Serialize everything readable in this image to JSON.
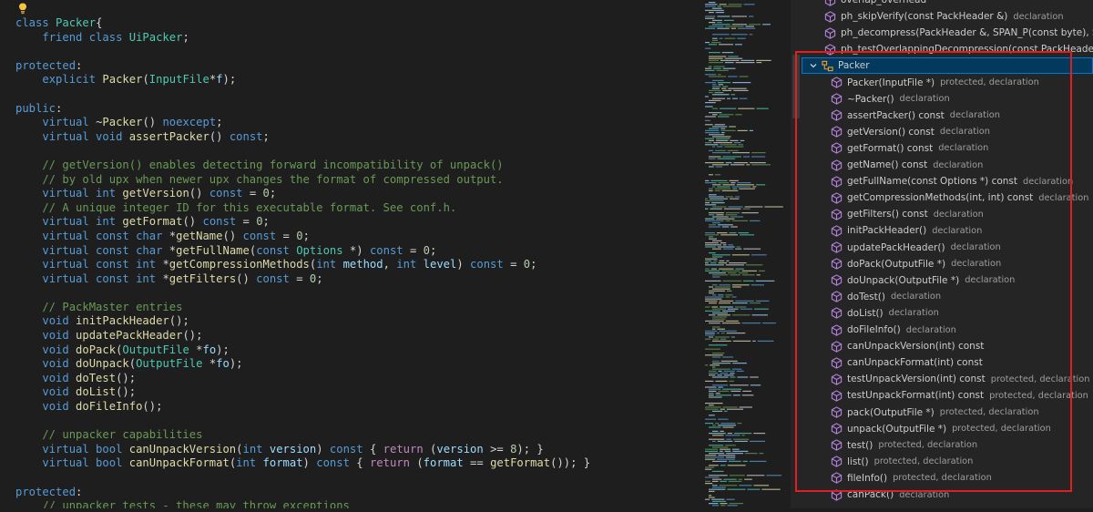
{
  "editor": {
    "lines": [
      [
        [
          "kw",
          "class "
        ],
        [
          "ty",
          "Packer"
        ],
        [
          "",
          "{"
        ]
      ],
      [
        [
          "",
          "    "
        ],
        [
          "kw",
          "friend class "
        ],
        [
          "ty",
          "UiPacker"
        ],
        [
          "",
          ";"
        ]
      ],
      [
        [
          "",
          ""
        ]
      ],
      [
        [
          "kw",
          "protected"
        ],
        [
          "",
          ":"
        ]
      ],
      [
        [
          "",
          "    "
        ],
        [
          "kw",
          "explicit "
        ],
        [
          "fn",
          "Packer"
        ],
        [
          "",
          "("
        ],
        [
          "ty",
          "InputFile"
        ],
        [
          "",
          "*"
        ],
        [
          "pm",
          "f"
        ],
        [
          "",
          ");"
        ]
      ],
      [
        [
          "",
          ""
        ]
      ],
      [
        [
          "kw",
          "public"
        ],
        [
          "",
          ":"
        ]
      ],
      [
        [
          "",
          "    "
        ],
        [
          "kw",
          "virtual "
        ],
        [
          "",
          "~"
        ],
        [
          "fn",
          "Packer"
        ],
        [
          "",
          "() "
        ],
        [
          "kw",
          "noexcept"
        ],
        [
          "",
          ";"
        ]
      ],
      [
        [
          "",
          "    "
        ],
        [
          "kw",
          "virtual void "
        ],
        [
          "fn",
          "assertPacker"
        ],
        [
          "",
          "() "
        ],
        [
          "kw",
          "const"
        ],
        [
          "",
          ";"
        ]
      ],
      [
        [
          "",
          ""
        ]
      ],
      [
        [
          "cm",
          "    // getVersion() enables detecting forward incompatibility of unpack()"
        ]
      ],
      [
        [
          "cm",
          "    // by old upx when newer upx changes the format of compressed output."
        ]
      ],
      [
        [
          "",
          "    "
        ],
        [
          "kw",
          "virtual int "
        ],
        [
          "fn",
          "getVersion"
        ],
        [
          "",
          "() "
        ],
        [
          "kw",
          "const "
        ],
        [
          "",
          "= "
        ],
        [
          "nu",
          "0"
        ],
        [
          "",
          ";"
        ]
      ],
      [
        [
          "cm",
          "    // A unique integer ID for this executable format. See conf.h."
        ]
      ],
      [
        [
          "",
          "    "
        ],
        [
          "kw",
          "virtual int "
        ],
        [
          "fn",
          "getFormat"
        ],
        [
          "",
          "() "
        ],
        [
          "kw",
          "const "
        ],
        [
          "",
          "= "
        ],
        [
          "nu",
          "0"
        ],
        [
          "",
          ";"
        ]
      ],
      [
        [
          "",
          "    "
        ],
        [
          "kw",
          "virtual const char "
        ],
        [
          "",
          "*"
        ],
        [
          "fn",
          "getName"
        ],
        [
          "",
          "() "
        ],
        [
          "kw",
          "const "
        ],
        [
          "",
          "= "
        ],
        [
          "nu",
          "0"
        ],
        [
          "",
          ";"
        ]
      ],
      [
        [
          "",
          "    "
        ],
        [
          "kw",
          "virtual const char "
        ],
        [
          "",
          "*"
        ],
        [
          "fn",
          "getFullName"
        ],
        [
          "",
          "("
        ],
        [
          "kw",
          "const "
        ],
        [
          "ty",
          "Options "
        ],
        [
          "",
          "*) "
        ],
        [
          "kw",
          "const "
        ],
        [
          "",
          "= "
        ],
        [
          "nu",
          "0"
        ],
        [
          "",
          ";"
        ]
      ],
      [
        [
          "",
          "    "
        ],
        [
          "kw",
          "virtual const int "
        ],
        [
          "",
          "*"
        ],
        [
          "fn",
          "getCompressionMethods"
        ],
        [
          "",
          "("
        ],
        [
          "kw",
          "int "
        ],
        [
          "pm",
          "method"
        ],
        [
          "",
          ", "
        ],
        [
          "kw",
          "int "
        ],
        [
          "pm",
          "level"
        ],
        [
          "",
          ") "
        ],
        [
          "kw",
          "const "
        ],
        [
          "",
          "= "
        ],
        [
          "nu",
          "0"
        ],
        [
          "",
          ";"
        ]
      ],
      [
        [
          "",
          "    "
        ],
        [
          "kw",
          "virtual const int "
        ],
        [
          "",
          "*"
        ],
        [
          "fn",
          "getFilters"
        ],
        [
          "",
          "() "
        ],
        [
          "kw",
          "const "
        ],
        [
          "",
          "= "
        ],
        [
          "nu",
          "0"
        ],
        [
          "",
          ";"
        ]
      ],
      [
        [
          "",
          ""
        ]
      ],
      [
        [
          "cm",
          "    // PackMaster entries"
        ]
      ],
      [
        [
          "",
          "    "
        ],
        [
          "kw",
          "void "
        ],
        [
          "fn",
          "initPackHeader"
        ],
        [
          "",
          "();"
        ]
      ],
      [
        [
          "",
          "    "
        ],
        [
          "kw",
          "void "
        ],
        [
          "fn",
          "updatePackHeader"
        ],
        [
          "",
          "();"
        ]
      ],
      [
        [
          "",
          "    "
        ],
        [
          "kw",
          "void "
        ],
        [
          "fn",
          "doPack"
        ],
        [
          "",
          "("
        ],
        [
          "ty",
          "OutputFile "
        ],
        [
          "",
          "*"
        ],
        [
          "pm",
          "fo"
        ],
        [
          "",
          ");"
        ]
      ],
      [
        [
          "",
          "    "
        ],
        [
          "kw",
          "void "
        ],
        [
          "fn",
          "doUnpack"
        ],
        [
          "",
          "("
        ],
        [
          "ty",
          "OutputFile "
        ],
        [
          "",
          "*"
        ],
        [
          "pm",
          "fo"
        ],
        [
          "",
          ");"
        ]
      ],
      [
        [
          "",
          "    "
        ],
        [
          "kw",
          "void "
        ],
        [
          "fn",
          "doTest"
        ],
        [
          "",
          "();"
        ]
      ],
      [
        [
          "",
          "    "
        ],
        [
          "kw",
          "void "
        ],
        [
          "fn",
          "doList"
        ],
        [
          "",
          "();"
        ]
      ],
      [
        [
          "",
          "    "
        ],
        [
          "kw",
          "void "
        ],
        [
          "fn",
          "doFileInfo"
        ],
        [
          "",
          "();"
        ]
      ],
      [
        [
          "",
          ""
        ]
      ],
      [
        [
          "cm",
          "    // unpacker capabilities"
        ]
      ],
      [
        [
          "",
          "    "
        ],
        [
          "kw",
          "virtual bool "
        ],
        [
          "fn",
          "canUnpackVersion"
        ],
        [
          "",
          "("
        ],
        [
          "kw",
          "int "
        ],
        [
          "pm",
          "version"
        ],
        [
          "",
          ") "
        ],
        [
          "kw",
          "const "
        ],
        [
          "",
          "{ "
        ],
        [
          "ct",
          "return "
        ],
        [
          "",
          "("
        ],
        [
          "pm",
          "version "
        ],
        [
          "",
          ">= "
        ],
        [
          "nu",
          "8"
        ],
        [
          "",
          "); }"
        ]
      ],
      [
        [
          "",
          "    "
        ],
        [
          "kw",
          "virtual bool "
        ],
        [
          "fn",
          "canUnpackFormat"
        ],
        [
          "",
          "("
        ],
        [
          "kw",
          "int "
        ],
        [
          "pm",
          "format"
        ],
        [
          "",
          ") "
        ],
        [
          "kw",
          "const "
        ],
        [
          "",
          "{ "
        ],
        [
          "ct",
          "return "
        ],
        [
          "",
          "("
        ],
        [
          "pm",
          "format "
        ],
        [
          "",
          "== "
        ],
        [
          "fn",
          "getFormat"
        ],
        [
          "",
          "()); }"
        ]
      ],
      [
        [
          "",
          ""
        ]
      ],
      [
        [
          "kw",
          "protected"
        ],
        [
          "",
          ":"
        ]
      ],
      [
        [
          "cm",
          "    // unpacker tests - these may throw exceptions"
        ]
      ]
    ]
  },
  "outline": {
    "items": [
      {
        "label": "overlap_overhead",
        "desc": "",
        "sel": false,
        "parent": false
      },
      {
        "label": "ph_skipVerify(const PackHeader &)",
        "desc": "declaration",
        "sel": false,
        "parent": false
      },
      {
        "label": "ph_decompress(PackHeader &, SPAN_P(const byte), SPAN_P(byte), bool, Filter *)",
        "desc": "",
        "sel": false,
        "parent": false
      },
      {
        "label": "ph_testOverlappingDecompression(const PackHeader &, SPAN_P(const byte), unsigned)",
        "desc": "",
        "sel": false,
        "parent": false
      },
      {
        "label": "Packer",
        "desc": "",
        "sel": true,
        "parent": true
      },
      {
        "label": "Packer(InputFile *)",
        "desc": "protected, declaration",
        "sel": false,
        "parent": false
      },
      {
        "label": "~Packer()",
        "desc": "declaration",
        "sel": false,
        "parent": false
      },
      {
        "label": "assertPacker() const",
        "desc": "declaration",
        "sel": false,
        "parent": false
      },
      {
        "label": "getVersion() const",
        "desc": "declaration",
        "sel": false,
        "parent": false
      },
      {
        "label": "getFormat() const",
        "desc": "declaration",
        "sel": false,
        "parent": false
      },
      {
        "label": "getName() const",
        "desc": "declaration",
        "sel": false,
        "parent": false
      },
      {
        "label": "getFullName(const Options *) const",
        "desc": "declaration",
        "sel": false,
        "parent": false
      },
      {
        "label": "getCompressionMethods(int, int) const",
        "desc": "declaration",
        "sel": false,
        "parent": false
      },
      {
        "label": "getFilters() const",
        "desc": "declaration",
        "sel": false,
        "parent": false
      },
      {
        "label": "initPackHeader()",
        "desc": "declaration",
        "sel": false,
        "parent": false
      },
      {
        "label": "updatePackHeader()",
        "desc": "declaration",
        "sel": false,
        "parent": false
      },
      {
        "label": "doPack(OutputFile *)",
        "desc": "declaration",
        "sel": false,
        "parent": false
      },
      {
        "label": "doUnpack(OutputFile *)",
        "desc": "declaration",
        "sel": false,
        "parent": false
      },
      {
        "label": "doTest()",
        "desc": "declaration",
        "sel": false,
        "parent": false
      },
      {
        "label": "doList()",
        "desc": "declaration",
        "sel": false,
        "parent": false
      },
      {
        "label": "doFileInfo()",
        "desc": "declaration",
        "sel": false,
        "parent": false
      },
      {
        "label": "canUnpackVersion(int) const",
        "desc": "",
        "sel": false,
        "parent": false
      },
      {
        "label": "canUnpackFormat(int) const",
        "desc": "",
        "sel": false,
        "parent": false
      },
      {
        "label": "testUnpackVersion(int) const",
        "desc": "protected, declaration",
        "sel": false,
        "parent": false
      },
      {
        "label": "testUnpackFormat(int) const",
        "desc": "protected, declaration",
        "sel": false,
        "parent": false
      },
      {
        "label": "pack(OutputFile *)",
        "desc": "protected, declaration",
        "sel": false,
        "parent": false
      },
      {
        "label": "unpack(OutputFile *)",
        "desc": "protected, declaration",
        "sel": false,
        "parent": false
      },
      {
        "label": "test()",
        "desc": "protected, declaration",
        "sel": false,
        "parent": false
      },
      {
        "label": "list()",
        "desc": "protected, declaration",
        "sel": false,
        "parent": false
      },
      {
        "label": "fileInfo()",
        "desc": "protected, declaration",
        "sel": false,
        "parent": false
      },
      {
        "label": "canPack()",
        "desc": "declaration",
        "sel": false,
        "parent": false
      }
    ]
  },
  "colors": {
    "editor_bg": "#1e1e1e",
    "panel_bg": "#252526",
    "selection_bg": "#04395e",
    "method_icon": "#b180d7",
    "class_icon": "#ee9d28",
    "highlight_box": "#e02020"
  },
  "icons": {
    "lightbulb": "lightbulb-icon",
    "method": "method-cube-icon",
    "class": "class-icon",
    "expand": "chevron-down-icon"
  }
}
